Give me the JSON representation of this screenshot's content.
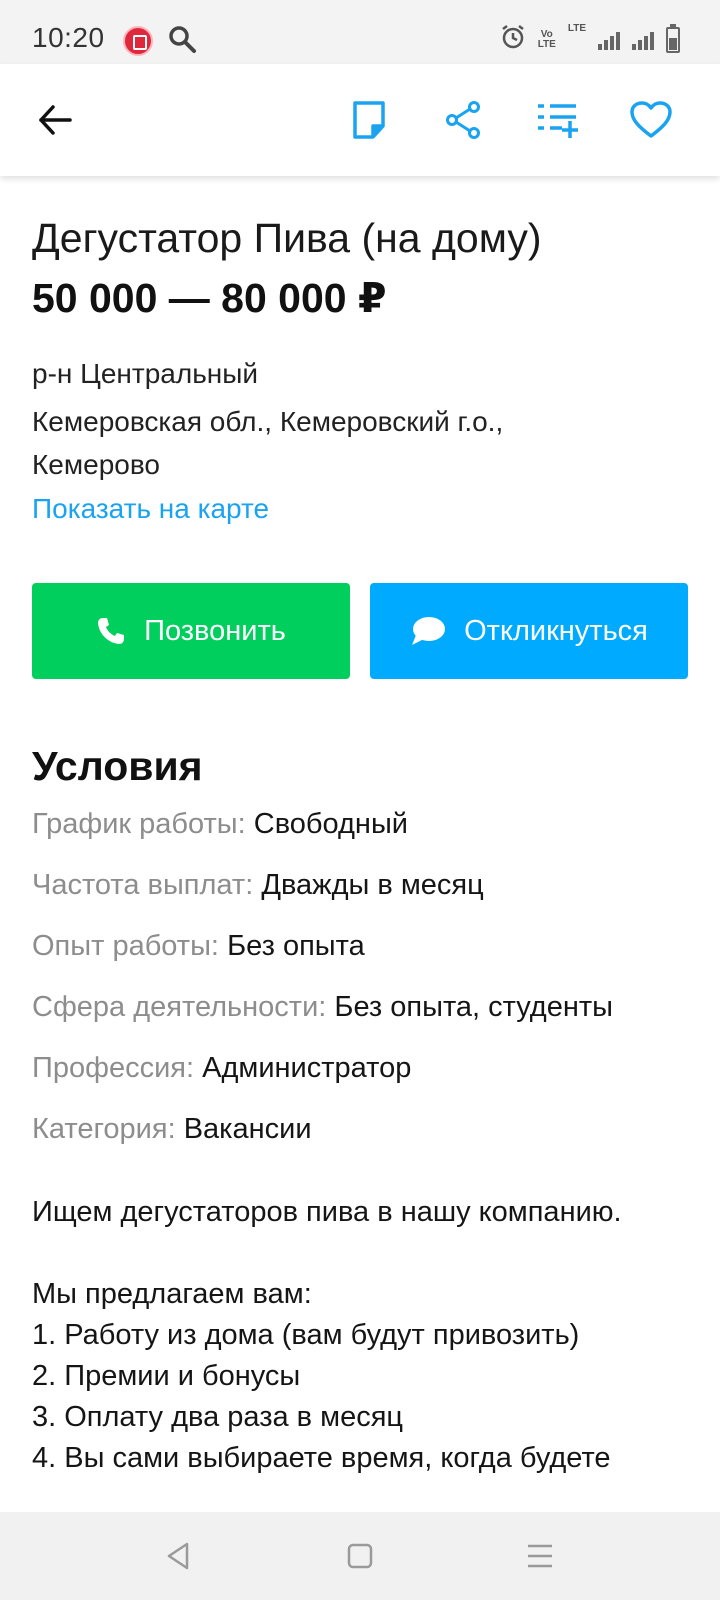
{
  "status_bar": {
    "time": "10:20",
    "volte_label_top": "Vo",
    "volte_label_bottom": "LTE",
    "network_label": "LTE"
  },
  "toolbar": {
    "back_icon": "arrow-left-icon",
    "note_icon": "note-icon",
    "share_icon": "share-icon",
    "add_to_list_icon": "playlist-add-icon",
    "favorite_icon": "heart-icon",
    "accent_color": "#1aa3f0"
  },
  "vacancy": {
    "title": "Дегустатор Пива (на дому)",
    "salary": "50 000 — 80 000 ₽",
    "district": "р-н Центральный",
    "region": "Кемеровская обл., Кемеровский г.о., Кемерово",
    "map_link": "Показать на карте"
  },
  "actions": {
    "call_label": "Позвонить",
    "call_color": "#00cf5d",
    "reply_label": "Откликнуться",
    "reply_color": "#00aaff"
  },
  "conditions": {
    "title": "Условия",
    "rows": [
      {
        "label": "График работы:",
        "value": "Свободный"
      },
      {
        "label": "Частота выплат:",
        "value": "Дважды в месяц"
      },
      {
        "label": "Опыт работы:",
        "value": "Без опыта"
      },
      {
        "label": "Сфера деятельности:",
        "value": "Без опыта, студенты"
      },
      {
        "label": "Профессия:",
        "value": "Администратор"
      },
      {
        "label": "Категория:",
        "value": "Вакансии"
      }
    ]
  },
  "description": {
    "intro": "Ищем дегустаторов пива в нашу компанию.",
    "offer_heading": "Мы предлагаем вам:",
    "items": [
      "1. Работу из дома (вам будут привозить)",
      "2. Премии и бонусы",
      "3. Оплату два раза в месяц",
      "4. Вы сами выбираете время, когда будете"
    ]
  },
  "nav": {
    "back_icon": "nav-back-icon",
    "home_icon": "nav-home-icon",
    "menu_icon": "nav-menu-icon"
  }
}
